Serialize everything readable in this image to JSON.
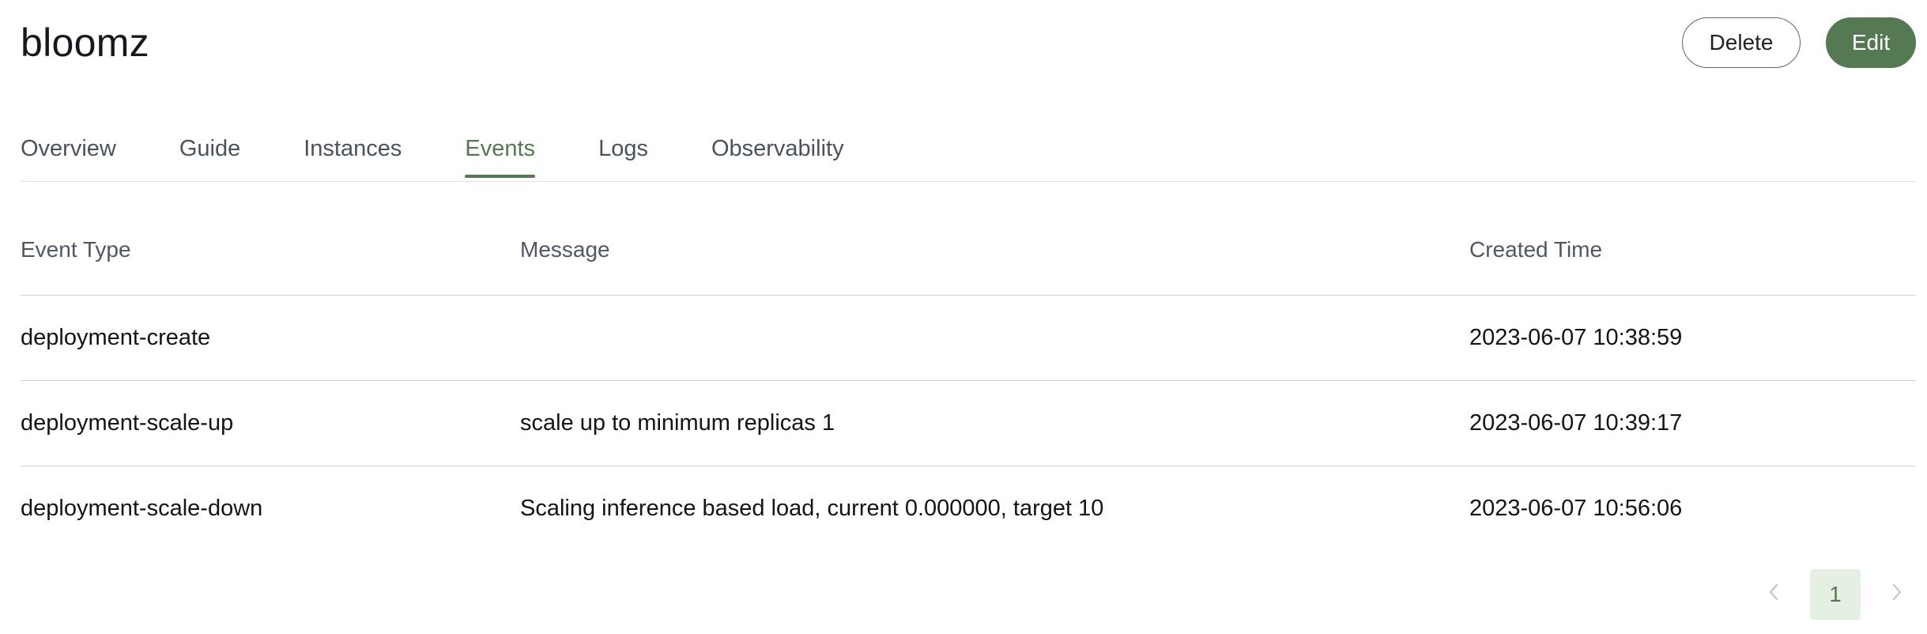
{
  "header": {
    "title": "bloomz",
    "delete_label": "Delete",
    "edit_label": "Edit"
  },
  "tabs": [
    {
      "label": "Overview",
      "active": false
    },
    {
      "label": "Guide",
      "active": false
    },
    {
      "label": "Instances",
      "active": false
    },
    {
      "label": "Events",
      "active": true
    },
    {
      "label": "Logs",
      "active": false
    },
    {
      "label": "Observability",
      "active": false
    }
  ],
  "table": {
    "columns": [
      "Event Type",
      "Message",
      "Created Time"
    ],
    "rows": [
      {
        "event_type": "deployment-create",
        "message": "",
        "created_time": "2023-06-07 10:38:59"
      },
      {
        "event_type": "deployment-scale-up",
        "message": "scale up to minimum replicas 1",
        "created_time": "2023-06-07 10:39:17"
      },
      {
        "event_type": "deployment-scale-down",
        "message": "Scaling inference based load, current 0.000000, target 10",
        "created_time": "2023-06-07 10:56:06"
      }
    ]
  },
  "pagination": {
    "prev_icon": "chevron-left-icon",
    "next_icon": "chevron-right-icon",
    "current_page": "1"
  },
  "colors": {
    "accent": "#557a52",
    "accent_light": "#e6efe3",
    "divider": "#cfd3d8"
  }
}
